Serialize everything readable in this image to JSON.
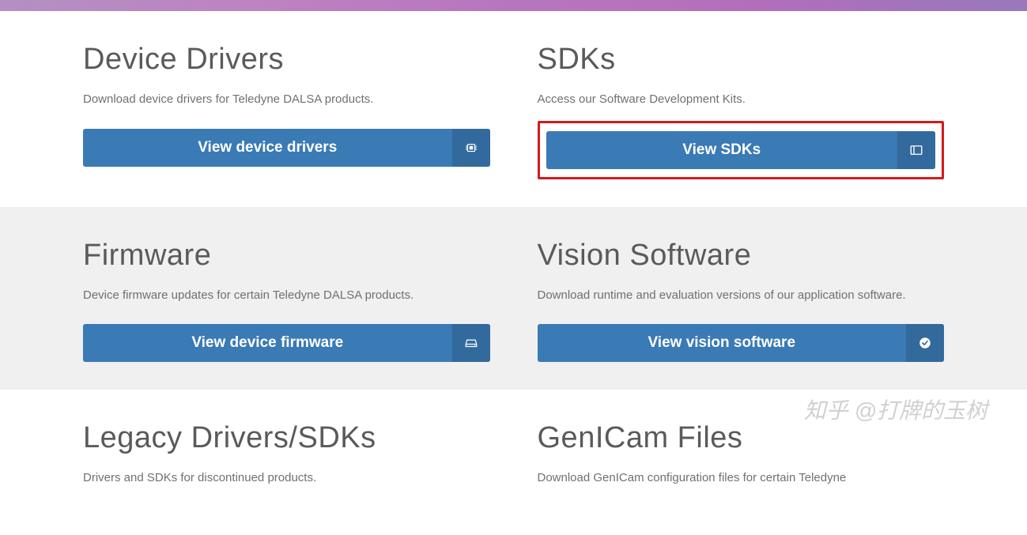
{
  "sections": {
    "device_drivers": {
      "title": "Device Drivers",
      "desc": "Download device drivers for Teledyne DALSA products.",
      "button": "View device drivers"
    },
    "sdks": {
      "title": "SDKs",
      "desc": "Access our Software Development Kits.",
      "button": "View SDKs"
    },
    "firmware": {
      "title": "Firmware",
      "desc": "Device firmware updates for certain Teledyne DALSA products.",
      "button": "View device firmware"
    },
    "vision_software": {
      "title": "Vision Software",
      "desc": "Download runtime and evaluation versions of our application software.",
      "button": "View vision software"
    },
    "legacy": {
      "title": "Legacy Drivers/SDKs",
      "desc": "Drivers and SDKs for discontinued products."
    },
    "genicam": {
      "title": "GenICam Files",
      "desc": "Download GenICam configuration files for certain Teledyne"
    }
  },
  "watermark": "知乎 @打牌的玉树"
}
